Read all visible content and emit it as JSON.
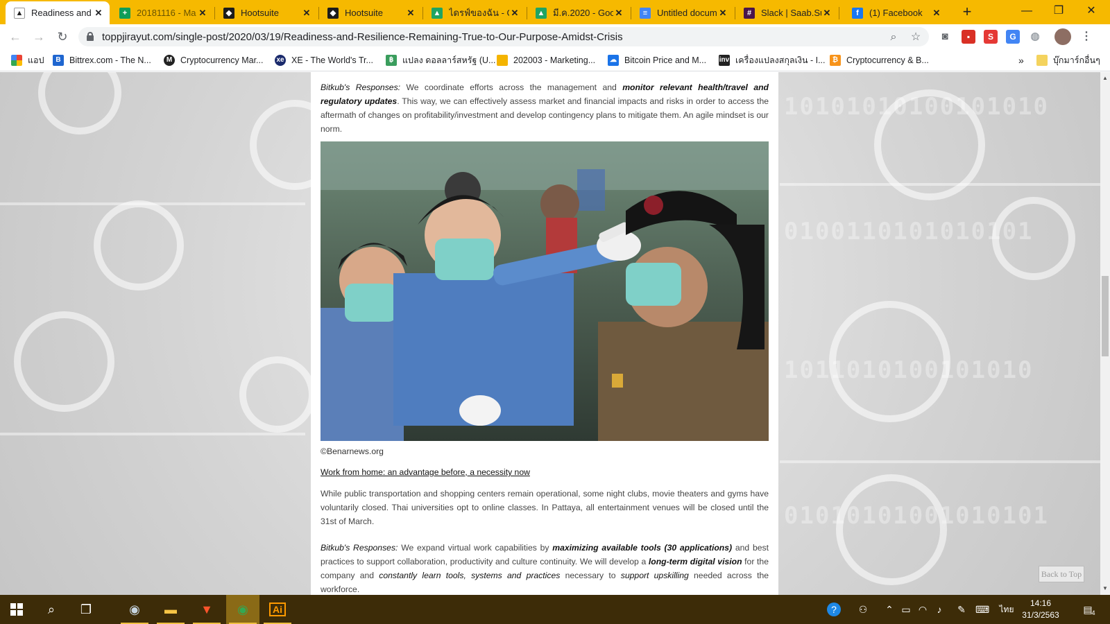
{
  "browser": {
    "tabs": [
      {
        "title": "Readiness and",
        "icon_color": "#ffffff",
        "icon_glyph": "▲"
      },
      {
        "title": "20181116 - Ma",
        "icon_color": "#0f9d58",
        "icon_glyph": "+"
      },
      {
        "title": "Hootsuite",
        "icon_color": "#1c1c1c",
        "icon_glyph": "◆"
      },
      {
        "title": "Hootsuite",
        "icon_color": "#1c1c1c",
        "icon_glyph": "◆"
      },
      {
        "title": "ไดรฟ์ของฉัน - Go",
        "icon_color": "#1fa463",
        "icon_glyph": "▲"
      },
      {
        "title": "มี.ค.2020 - Goo",
        "icon_color": "#1fa463",
        "icon_glyph": "▲"
      },
      {
        "title": "Untitled docum",
        "icon_color": "#4285f4",
        "icon_glyph": "≡"
      },
      {
        "title": "Slack | Saab.Su",
        "icon_color": "#4a154b",
        "icon_glyph": "#"
      },
      {
        "title": "(1) Facebook",
        "icon_color": "#1877f2",
        "icon_glyph": "f"
      }
    ],
    "new_tab_glyph": "+",
    "window_controls": {
      "minimize": "—",
      "maximize": "❐",
      "close": "✕"
    },
    "url": "toppjirayut.com/single-post/2020/03/19/Readiness-and-Resilience-Remaining-True-to-Our-Purpose-Amidst-Crisis",
    "bookmarks": [
      {
        "label": "แอป",
        "icon": "apps-icon",
        "color": "#ea4335"
      },
      {
        "label": "Bittrex.com - The N...",
        "icon": "bittrex-icon",
        "color": "#1f66d0"
      },
      {
        "label": "Cryptocurrency Mar...",
        "icon": "coinmarketcap-icon",
        "color": "#222222"
      },
      {
        "label": "XE - The World's Tr...",
        "icon": "xe-icon",
        "color": "#1a2a6c"
      },
      {
        "label": "แปลง ดอลลาร์สหรัฐ (U...",
        "icon": "currency-icon",
        "color": "#3a9d5d"
      },
      {
        "label": "202003 - Marketing...",
        "icon": "folder-icon",
        "color": "#f4b400"
      },
      {
        "label": "Bitcoin Price and M...",
        "icon": "bitcoin-icon",
        "color": "#1a73e8"
      },
      {
        "label": "เครื่องแปลงสกุลเงิน - I...",
        "icon": "investing-icon",
        "color": "#222222"
      },
      {
        "label": "Cryptocurrency & B...",
        "icon": "crypto-icon",
        "color": "#f7931a"
      }
    ],
    "bookmarks_overflow": "»",
    "other_bookmarks": "บุ๊กมาร์กอื่นๆ"
  },
  "article": {
    "para1": {
      "lead": "Bitkub's Responses:",
      "t1": " We coordinate efforts across the management and ",
      "em1": "monitor relevant health/travel and regulatory updates",
      "t2": ". This way, we can effectively assess market and financial impacts and risks in order to access the aftermath of changes on profitability/investment and develop contingency plans to mitigate them. An agile mindset is our norm."
    },
    "photo_caption": "©Benarnews.org",
    "section_heading": "Work from home: an advantage before, a necessity now",
    "para2": "While public transportation and shopping centers remain operational,  some night clubs, movie theaters and gyms have voluntarily closed. Thai universities opt to online classes. In Pattaya, all entertainment venues will be closed until the 31st of March.",
    "para3": {
      "lead": "Bitkub's Responses:",
      "t1": " We expand virtual work capabilities by ",
      "em1": "maximizing available tools (30 applications)",
      "t2": " and best practices to support collaboration, productivity and culture continuity. We will develop a ",
      "em2": "long-term digital vision",
      "t3": " for the company and ",
      "em3": "constantly learn tools, systems and practices",
      "t4": " necessary to ",
      "em4": "support upskilling",
      "t5": " needed across the workforce."
    },
    "back_to_top": "Back to Top",
    "background_digits": [
      "10101010100101010",
      "0100110101010101",
      "1011010100101010",
      "01010101001010101"
    ]
  },
  "taskbar": {
    "apps": [
      {
        "name": "steam",
        "glyph": "◉",
        "color": "#c7d5e0"
      },
      {
        "name": "file-explorer",
        "glyph": "▬",
        "color": "#f6c445"
      },
      {
        "name": "brave",
        "glyph": "▼",
        "color": "#fb542b"
      },
      {
        "name": "chrome",
        "glyph": "◉",
        "color": "#34a853"
      },
      {
        "name": "illustrator",
        "glyph": "Ai",
        "color": "#ff9a00"
      }
    ],
    "language": "ไทย",
    "time": "14:16",
    "date": "31/3/2563",
    "notification_count": "4"
  }
}
